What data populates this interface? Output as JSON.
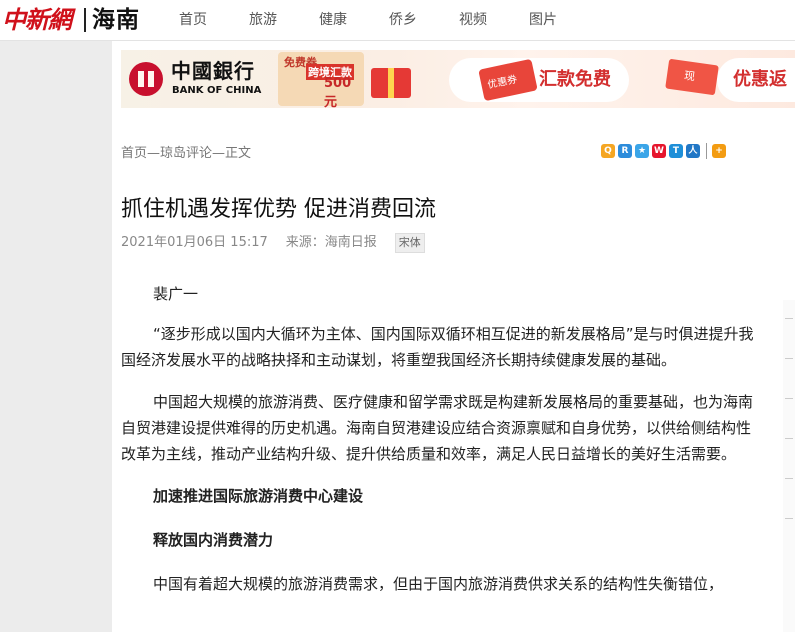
{
  "header": {
    "logo_main": "中新網",
    "logo_region": "海南",
    "nav": [
      "首页",
      "旅游",
      "健康",
      "侨乡",
      "视频",
      "图片"
    ]
  },
  "banner": {
    "boc_cn": "中國銀行",
    "boc_en": "BANK OF CHINA",
    "promo_a": "免费券",
    "promo_b": "跨境汇款",
    "promo_c": "500元",
    "ticket1": "优惠券",
    "slogan1": "汇款免费",
    "ticket2": "现",
    "slogan2": "优惠返"
  },
  "breadcrumb": "首页—琼岛评论—正文",
  "share_icons": [
    "qzone-icon",
    "renren-icon",
    "qq-icon",
    "weibo-icon",
    "tencent-weibo-icon",
    "people-icon",
    "more-share-icon"
  ],
  "article": {
    "title": "抓住机遇发挥优势 促进消费回流",
    "date": "2021年01月06日 15:17",
    "source": "来源：海南日报",
    "font_toggle": "宋体",
    "author": "裴广一",
    "paragraphs": [
      "“逐步形成以国内大循环为主体、国内国际双循环相互促进的新发展格局”是与时俱进提升我国经济发展水平的战略抉择和主动谋划，将重塑我国经济长期持续健康发展的基础。",
      "中国超大规模的旅游消费、医疗健康和留学需求既是构建新发展格局的重要基础，也为海南自贸港建设提供难得的历史机遇。海南自贸港建设应结合资源禀赋和自身优势，以供给侧结构性改革为主线，推动产业结构升级、提升供给质量和效率，满足人民日益增长的美好生活需要。"
    ],
    "heading1": "加速推进国际旅游消费中心建设",
    "heading2": "释放国内消费潜力",
    "paragraph_last": "中国有着超大规模的旅游消费需求，但由于国内旅游消费供求关系的结构性失衡错位，"
  },
  "colors": {
    "brand_red": "#d0111b",
    "text": "#222222",
    "muted": "#888888"
  }
}
